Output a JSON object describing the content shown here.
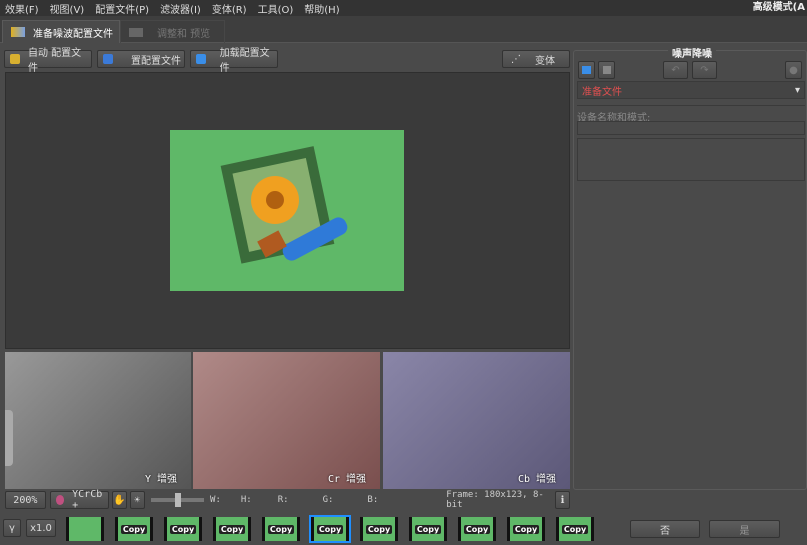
{
  "menu": [
    "效果(F)",
    "视图(V)",
    "配置文件(P)",
    "滤波器(I)",
    "变体(R)",
    "工具(O)",
    "帮助(H)"
  ],
  "mode_label": "高级模式(A",
  "tabs": [
    {
      "label": "准备噪波配置文件",
      "active": true
    },
    {
      "label": "调整和 预览",
      "active": false
    }
  ],
  "toolbar": {
    "auto_profile": "自动 配置文件",
    "set_profile": "置配置文件",
    "load_profile": "加载配置文件",
    "variant": "变体"
  },
  "channels": [
    {
      "label": "Y 增强"
    },
    {
      "label": "Cr 增强"
    },
    {
      "label": "Cb 增强"
    }
  ],
  "status": {
    "zoom": "200%",
    "colorspace": "YCrCb +",
    "w": "W:",
    "h": "H:",
    "r": "R:",
    "g": "G:",
    "b": "B:",
    "frame": "Frame: 180x123, 8-bit"
  },
  "bottom": {
    "gamma": "γ",
    "scale": "x1.0",
    "thumb_label": "Copy",
    "no": "否",
    "yes": "是"
  },
  "thumbnails": {
    "count": 11,
    "selected": 6
  },
  "right_panel": {
    "title": "噪声降噪",
    "profile_select": "准备文件",
    "device_label": "设备名称和模式:"
  },
  "colors": {
    "accent": "#1f8fff",
    "image_bg": "#5fb868",
    "profile_text": "#e05050"
  }
}
